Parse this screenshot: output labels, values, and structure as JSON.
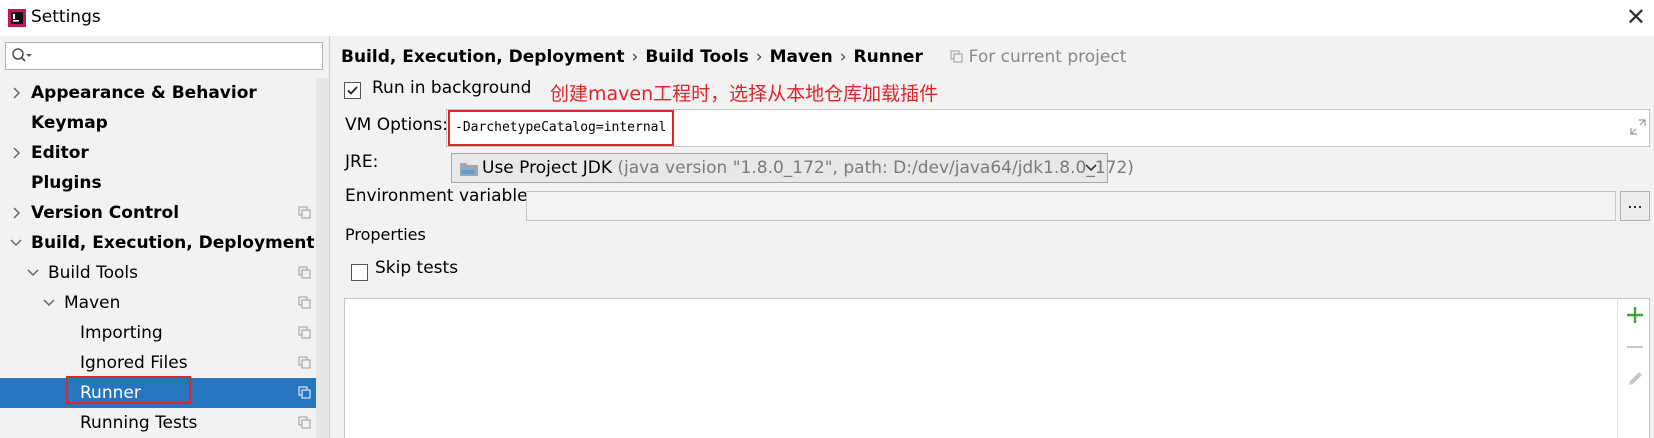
{
  "window": {
    "title": "Settings",
    "close_glyph": "✕"
  },
  "sidebar": {
    "search": {
      "placeholder": "",
      "value": ""
    },
    "items": [
      {
        "label": "Appearance & Behavior",
        "level": 0,
        "bold": true,
        "arrow": "right",
        "copy": false
      },
      {
        "label": "Keymap",
        "level": 0,
        "bold": true,
        "arrow": "none",
        "copy": false
      },
      {
        "label": "Editor",
        "level": 0,
        "bold": true,
        "arrow": "right",
        "copy": false
      },
      {
        "label": "Plugins",
        "level": 0,
        "bold": true,
        "arrow": "none",
        "copy": false
      },
      {
        "label": "Version Control",
        "level": 0,
        "bold": true,
        "arrow": "right",
        "copy": true
      },
      {
        "label": "Build, Execution, Deployment",
        "level": 0,
        "bold": true,
        "arrow": "down",
        "copy": false
      },
      {
        "label": "Build Tools",
        "level": 1,
        "bold": false,
        "arrow": "down",
        "copy": true
      },
      {
        "label": "Maven",
        "level": 2,
        "bold": false,
        "arrow": "down",
        "copy": true
      },
      {
        "label": "Importing",
        "level": 3,
        "bold": false,
        "arrow": "none",
        "copy": true
      },
      {
        "label": "Ignored Files",
        "level": 3,
        "bold": false,
        "arrow": "none",
        "copy": true
      },
      {
        "label": "Runner",
        "level": 3,
        "bold": false,
        "arrow": "none",
        "copy": true,
        "selected": true
      },
      {
        "label": "Running Tests",
        "level": 3,
        "bold": false,
        "arrow": "none",
        "copy": true
      }
    ]
  },
  "breadcrumb": {
    "parts": [
      "Build, Execution, Deployment",
      "Build Tools",
      "Maven",
      "Runner"
    ],
    "separator": "›",
    "scope": "For current project"
  },
  "form": {
    "run_in_background": {
      "label": "Run in background",
      "checked": true
    },
    "annotation": "创建maven工程时，选择从本地仓库加载插件",
    "vm_options": {
      "label": "VM Options:",
      "value": "-DarchetypeCatalog=internal"
    },
    "jre": {
      "label": "JRE:",
      "selected": "Use Project JDK",
      "detail": "(java version \"1.8.0_172\", path: D:/dev/java64/jdk1.8.0_172)"
    },
    "env_vars": {
      "label": "Environment variables:",
      "value": "",
      "button": "..."
    },
    "properties": {
      "label": "Properties"
    },
    "skip_tests": {
      "label": "Skip tests",
      "checked": false
    }
  },
  "colors": {
    "accent": "#2675bf",
    "annotation_red": "#e0242a",
    "add_green": "#3fa43a"
  }
}
